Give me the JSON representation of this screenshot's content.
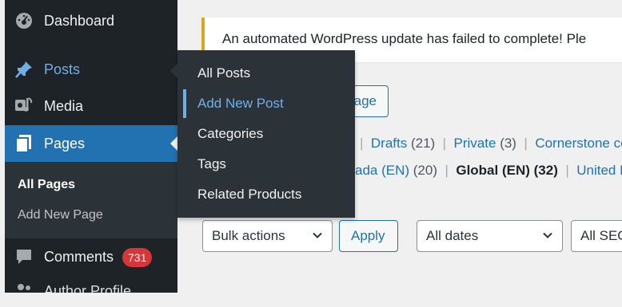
{
  "menu": {
    "dashboard": "Dashboard",
    "posts": "Posts",
    "media": "Media",
    "pages": "Pages",
    "pages_sub": [
      "All Pages",
      "Add New Page"
    ],
    "comments": "Comments",
    "comments_count": "731",
    "author_profile": "Author Profile"
  },
  "flyout": {
    "items": [
      "All Posts",
      "Add New Post",
      "Categories",
      "Tags",
      "Related Products"
    ]
  },
  "notice": {
    "text": "An automated WordPress update has failed to complete! Ple"
  },
  "add_new_button": "age",
  "views": {
    "row1": [
      {
        "label": "Drafts",
        "count": "(21)"
      },
      {
        "label": "Private",
        "count": "(3)"
      },
      {
        "label": "Cornerstone co",
        "count": ""
      }
    ],
    "row1_prefix_sep": "|",
    "row2": [
      {
        "label": "ada (EN)",
        "count": "(20)"
      },
      {
        "label": "Global (EN)",
        "count": "(32)"
      },
      {
        "label": "United Ki",
        "count": ""
      }
    ]
  },
  "bulk": {
    "bulk_actions": "Bulk actions",
    "apply": "Apply",
    "dates": "All dates",
    "seo": "All SEO"
  },
  "colors": {
    "menu_bg": "#1d2327",
    "submenu_bg": "#2c3338",
    "accent": "#2271b1",
    "link_hover": "#72aee6",
    "notice_border": "#dba617",
    "badge": "#d63638"
  }
}
